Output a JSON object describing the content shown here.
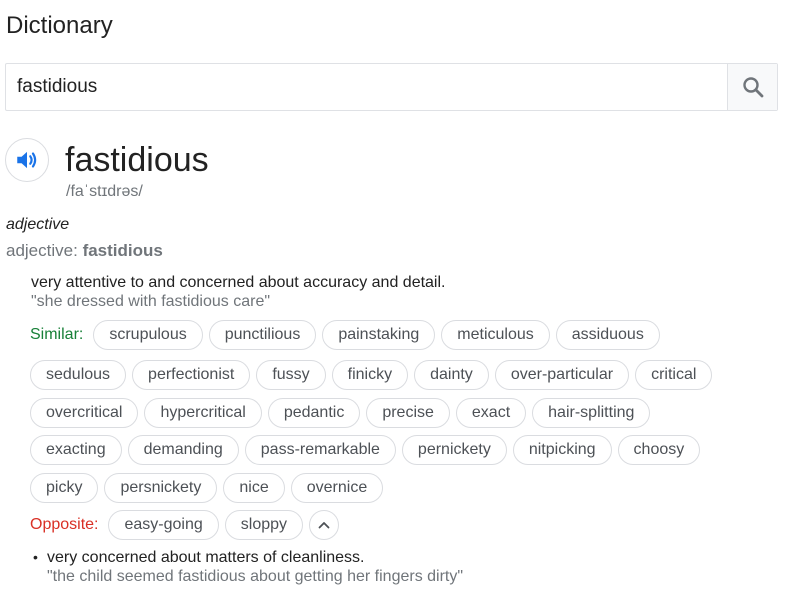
{
  "header": {
    "title": "Dictionary"
  },
  "search": {
    "value": "fastidious"
  },
  "entry": {
    "word": "fastidious",
    "phonetic": "/faˈstɪdrəs/",
    "part_of_speech": "adjective",
    "forms_label": "adjective:",
    "forms_value": "fastidious"
  },
  "sense1": {
    "definition": "very attentive to and concerned about accuracy and detail.",
    "example": "\"she dressed with fastidious care\"",
    "similar_label": "Similar:",
    "similar_rows": [
      [
        "scrupulous",
        "punctilious",
        "painstaking",
        "meticulous",
        "assiduous"
      ],
      [
        "sedulous",
        "perfectionist",
        "fussy",
        "finicky",
        "dainty",
        "over-particular",
        "critical"
      ],
      [
        "overcritical",
        "hypercritical",
        "pedantic",
        "precise",
        "exact",
        "hair-splitting"
      ],
      [
        "exacting",
        "demanding",
        "pass-remarkable",
        "pernickety",
        "nitpicking",
        "choosy"
      ],
      [
        "picky",
        "persnickety",
        "nice",
        "overnice"
      ]
    ],
    "opposite_label": "Opposite:",
    "opposite": [
      "easy-going",
      "sloppy"
    ]
  },
  "sense2": {
    "bullet": "•",
    "definition": "very concerned about matters of cleanliness.",
    "example": "\"the child seemed fastidious about getting her fingers dirty\""
  },
  "colors": {
    "similar": "#188038",
    "opposite": "#d93025",
    "speaker": "#1a73e8"
  }
}
